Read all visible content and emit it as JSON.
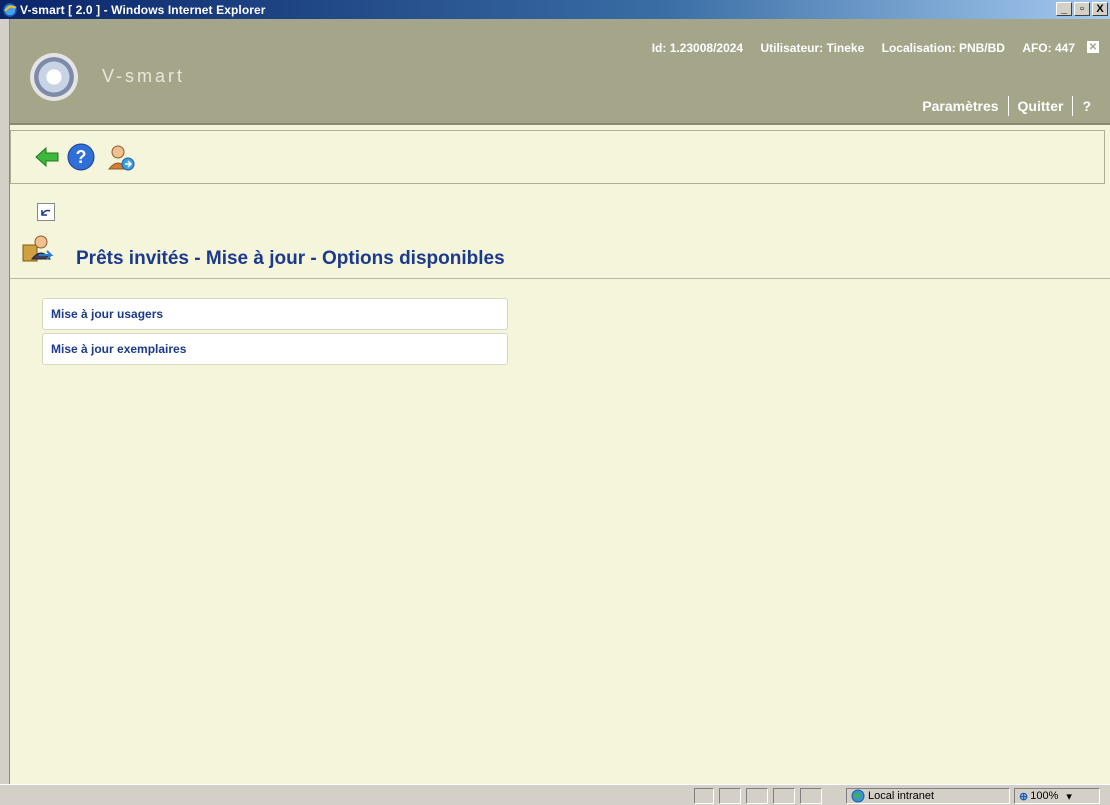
{
  "window": {
    "title": "V-smart [ 2.0 ] - Windows Internet Explorer",
    "minimize": "_",
    "maximize": "▫",
    "close": "X"
  },
  "header": {
    "logo_text": "V-smart",
    "id_label": "Id: 1.23008/2024",
    "user_label": "Utilisateur: Tineke",
    "location_label": "Localisation: PNB/BD",
    "afo_label": "AFO: 447",
    "links": {
      "settings": "Paramètres",
      "quit": "Quitter",
      "help": "?"
    }
  },
  "toolbar": {
    "icons": [
      "back-arrow-icon",
      "help-icon",
      "user-switch-icon"
    ]
  },
  "page": {
    "title": "Prêts invités - Mise à jour - Options disponibles",
    "options": [
      {
        "label": "Mise à jour usagers"
      },
      {
        "label": "Mise à jour exemplaires"
      }
    ]
  },
  "statusbar": {
    "zone": "Local intranet",
    "zoom": "100%"
  },
  "colors": {
    "accent": "#1c3a8c",
    "header_bg": "#a5a58a",
    "content_bg": "#f5f5dc"
  }
}
